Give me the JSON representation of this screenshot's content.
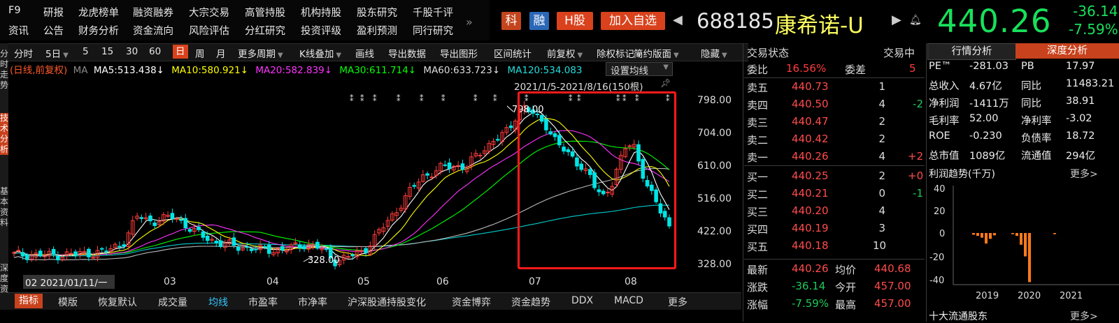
{
  "nav": {
    "row1": [
      "F9",
      "研报",
      "龙虎榜单",
      "融资融券",
      "大宗交易",
      "高管持股",
      "机构持股",
      "股东研究",
      "千股千评"
    ],
    "row2": [
      "资讯",
      "公告",
      "财务分析",
      "资金流向",
      "风险评估",
      "分红研究",
      "投资评级",
      "盈利预测",
      "同行研究"
    ],
    "more": "»"
  },
  "stock": {
    "tags": [
      {
        "label": "科",
        "color": "#c4451d"
      },
      {
        "label": "融",
        "color": "#2b67b6"
      },
      {
        "label": "H股",
        "color": "#d9421c"
      },
      {
        "label": "加入自选",
        "color": "#d9421c"
      }
    ],
    "code": "688185",
    "name": "康希诺-U",
    "price": "440.26",
    "change": "-36.14",
    "change_pct": "-7.59%"
  },
  "toolbar": {
    "items": [
      "分时",
      "5日",
      "5",
      "15",
      "30",
      "60",
      "日",
      "周",
      "月",
      "更多周期",
      "K线叠加",
      "画线",
      "导出数据",
      "导出图形",
      "区间统计",
      "前复权",
      "除权标记",
      "简约版面",
      "隐藏"
    ],
    "active": "日"
  },
  "left_tabs": [
    "分时走势",
    "技术分析",
    "基本资料",
    "深度资料"
  ],
  "ma": {
    "prefix": "(日线,前复权)",
    "ma_label": "MA",
    "ma5": "MA5:513.438↓",
    "ma10": "MA10:580.921↓",
    "ma20": "MA20:582.839↓",
    "ma30": "MA30:611.714↓",
    "ma60": "MA60:633.723↓",
    "ma120": "MA120:534.083",
    "settings": "设置均线",
    "range": "2021/1/5-2021/8/16(150根)"
  },
  "chart": {
    "y_ticks": [
      "798.00",
      "704.00",
      "610.00",
      "516.00",
      "422.00",
      "328.00"
    ],
    "x_ticks": [
      "03",
      "04",
      "05",
      "06",
      "07",
      "08"
    ],
    "cursor_date": "2021/01/11/一",
    "cursor_prefix": "02",
    "high_label": "798.00",
    "low_label": "328.00",
    "colors": {
      "up": "#ff3b3b",
      "down": "#00e5e5",
      "ma5": "#ffffff",
      "ma10": "#ffff00",
      "ma20": "#ff33ff",
      "ma30": "#00ff00",
      "ma60": "#bbbbbb",
      "ma120": "#00cccc",
      "highlight": "#ff1a1a"
    }
  },
  "bottom_tabs": [
    "指标",
    "模版",
    "恢复默认",
    "成交量",
    "均线",
    "市盈率",
    "市净率",
    "沪深股通持股变化",
    "资金博弈",
    "资金趋势",
    "DDX",
    "MACD",
    "更多"
  ],
  "orderbook": {
    "status_label": "交易状态",
    "status_value": "交易中",
    "wb_label": "委比",
    "wb_value": "16.56%",
    "wc_label": "委差",
    "wc_value": "5",
    "asks": [
      {
        "label": "卖五",
        "price": "440.73",
        "vol": "1",
        "chg": ""
      },
      {
        "label": "卖四",
        "price": "440.50",
        "vol": "4",
        "chg": "-2"
      },
      {
        "label": "卖三",
        "price": "440.47",
        "vol": "2",
        "chg": ""
      },
      {
        "label": "卖二",
        "price": "440.42",
        "vol": "2",
        "chg": ""
      },
      {
        "label": "卖一",
        "price": "440.26",
        "vol": "4",
        "chg": "+2"
      }
    ],
    "bids": [
      {
        "label": "买一",
        "price": "440.25",
        "vol": "2",
        "chg": "+0"
      },
      {
        "label": "买二",
        "price": "440.21",
        "vol": "0",
        "chg": "-1"
      },
      {
        "label": "买三",
        "price": "440.20",
        "vol": "4",
        "chg": ""
      },
      {
        "label": "买四",
        "price": "440.19",
        "vol": "3",
        "chg": ""
      },
      {
        "label": "买五",
        "price": "440.18",
        "vol": "10",
        "chg": ""
      }
    ],
    "stats": [
      {
        "l1": "最新",
        "v1": "440.26",
        "l2": "均价",
        "v2": "440.68"
      },
      {
        "l1": "涨跌",
        "v1": "-36.14",
        "l2": "今开",
        "v2": "457.00"
      },
      {
        "l1": "涨幅",
        "v1": "-7.59%",
        "l2": "最高",
        "v2": "457.00"
      }
    ]
  },
  "analysis": {
    "tab1": "行情分析",
    "tab2": "深度分析",
    "rows": [
      {
        "l1": "PE™",
        "v1": "-281.03",
        "l2": "PB",
        "v2": "17.97"
      },
      {
        "l1": "总收入",
        "v1": "4.67亿",
        "l2": "同比",
        "v2": "11483.21"
      },
      {
        "l1": "净利润",
        "v1": "-1411万",
        "l2": "同比",
        "v2": "38.91"
      },
      {
        "l1": "毛利率",
        "v1": "52.00",
        "l2": "净利率",
        "v2": "-3.02"
      },
      {
        "l1": "ROE",
        "v1": "-0.230",
        "l2": "负债率",
        "v2": "18.72"
      },
      {
        "l1": "总市值",
        "v1": "1089亿",
        "l2": "流通值",
        "v2": "294亿"
      }
    ],
    "profit_title": "利润趋势(千万)",
    "profit_more": "更多>",
    "profit_y": [
      "40",
      "20",
      "0",
      "-20",
      "-40"
    ],
    "profit_years": [
      "2019",
      "2020",
      "2021"
    ],
    "bottom_title": "十大流通股东",
    "bottom_more": "更多>"
  }
}
